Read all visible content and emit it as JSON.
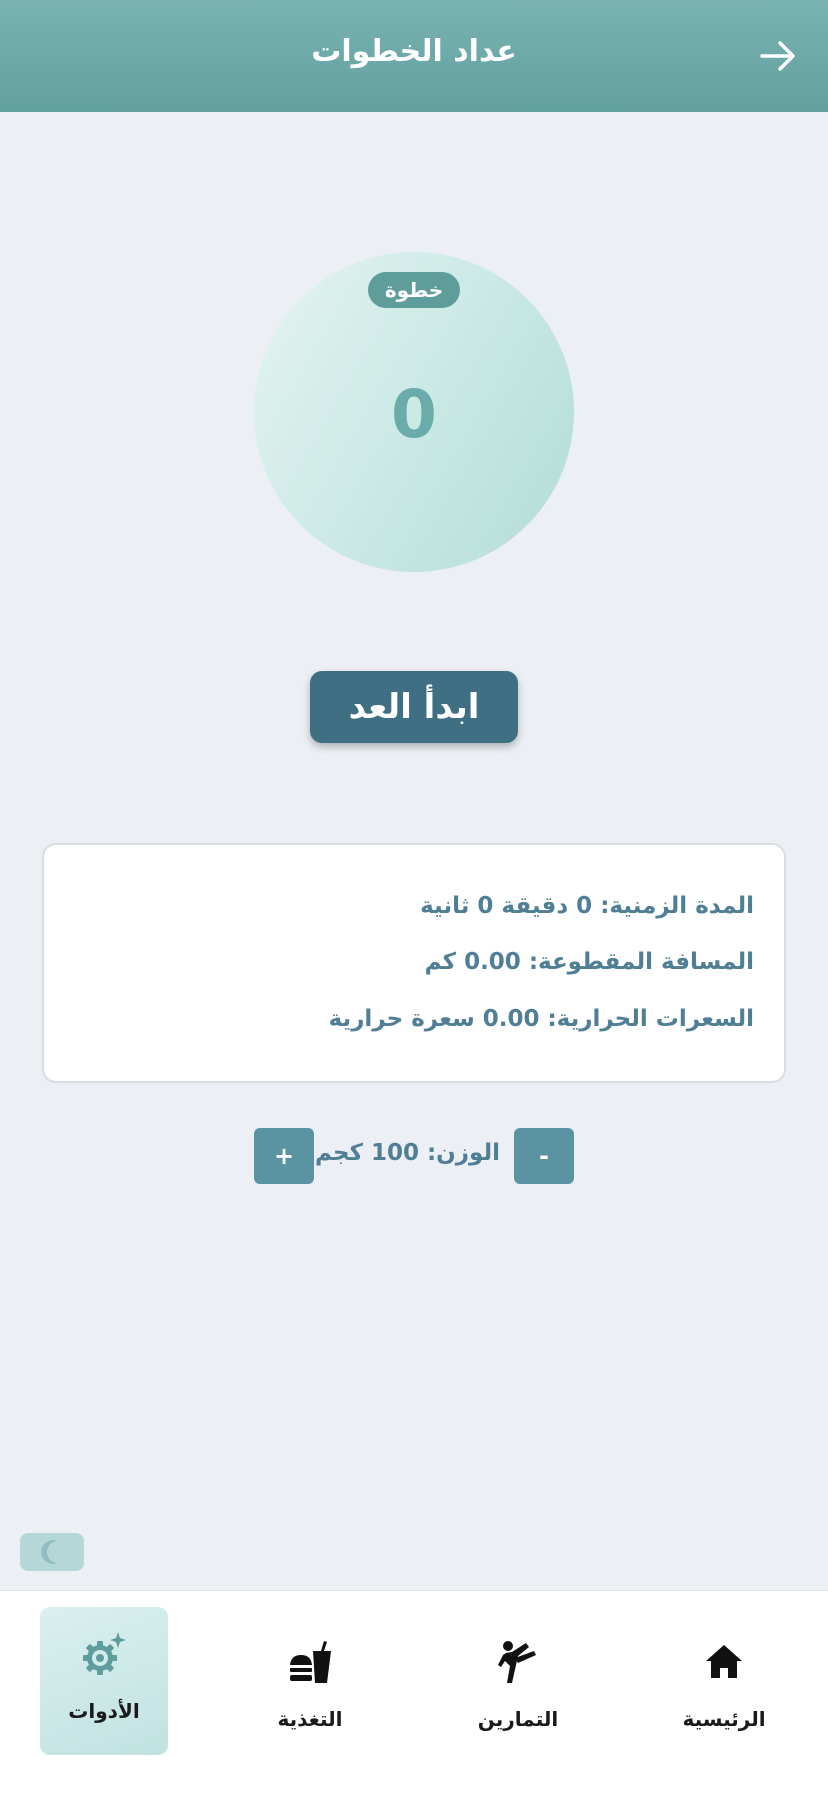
{
  "header": {
    "title": "عداد الخطوات",
    "back_icon": "arrow-right-icon"
  },
  "counter": {
    "badge_label": "خطوة",
    "steps": "0"
  },
  "start_button": {
    "label": "ابدأ العد"
  },
  "stats": {
    "duration": "المدة الزمنية: 0 دقيقة 0 ثانية",
    "distance": "المسافة المقطوعة: 0.00 كم",
    "calories": "السعرات الحرارية: 0.00 سعرة حرارية"
  },
  "weight": {
    "label": "الوزن: 100 كجم",
    "decrease_label": "-",
    "increase_label": "+"
  },
  "theme_toggle": {
    "icon": "moon-icon"
  },
  "nav": {
    "items": [
      {
        "label": "الرئيسية",
        "icon": "home-icon",
        "active": false
      },
      {
        "label": "التمارين",
        "icon": "kick-icon",
        "active": false
      },
      {
        "label": "التغذية",
        "icon": "fastfood-icon",
        "active": false
      },
      {
        "label": "الأدوات",
        "icon": "settings-sparkle-icon",
        "active": true
      }
    ]
  },
  "colors": {
    "header": "#6aa8a7",
    "accent": "#5e9d9b",
    "start_button": "#3f6f82",
    "stat_text": "#4f7e95",
    "background": "#eceff4"
  }
}
